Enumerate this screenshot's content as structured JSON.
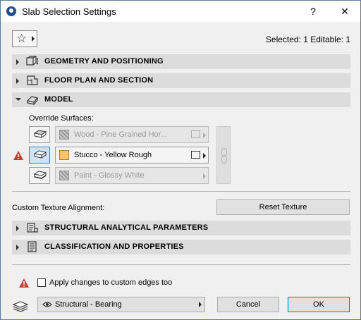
{
  "window": {
    "title": "Slab Selection Settings",
    "help_label": "?",
    "close_label": "✕"
  },
  "header": {
    "selection_info": "Selected: 1 Editable: 1"
  },
  "sections": {
    "geometry": "GEOMETRY AND POSITIONING",
    "floorplan": "FLOOR PLAN AND SECTION",
    "model": "MODEL",
    "structural": "STRUCTURAL ANALYTICAL PARAMETERS",
    "classification": "CLASSIFICATION AND PROPERTIES"
  },
  "model": {
    "override_label": "Override Surfaces:",
    "surfaces": [
      {
        "material": "Wood - Pine Grained Hor...",
        "enabled": false
      },
      {
        "material": "Stucco - Yellow Rough",
        "enabled": true
      },
      {
        "material": "Paint - Glossy White",
        "enabled": false
      }
    ]
  },
  "texture": {
    "label": "Custom Texture Alignment:",
    "reset_label": "Reset Texture"
  },
  "footer": {
    "checkbox_label": "Apply changes to custom edges too",
    "checkbox_checked": false,
    "layer_value": "Structural - Bearing",
    "cancel_label": "Cancel",
    "ok_label": "OK"
  },
  "colors": {
    "accent": "#0078d7",
    "section_bg": "#dcdcdc",
    "warning": "#d23a2e",
    "selected_swatch": "#ffc56b"
  }
}
